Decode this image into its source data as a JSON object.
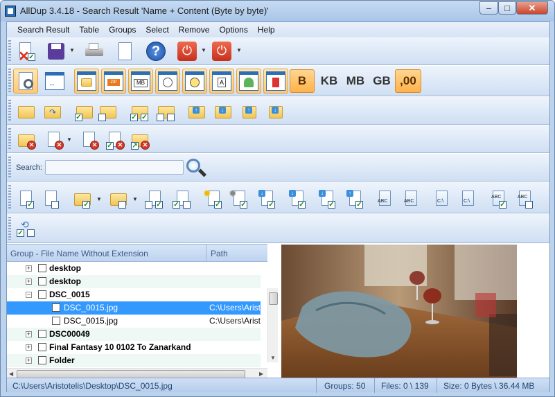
{
  "window": {
    "title": "AllDup 3.4.18 - Search Result 'Name + Content (Byte by byte)'"
  },
  "menu": [
    "Search Result",
    "Table",
    "Groups",
    "Select",
    "Remove",
    "Options",
    "Help"
  ],
  "units": {
    "b": "B",
    "kb": "KB",
    "mb": "MB",
    "gb": "GB",
    "dec": ",00",
    "active": [
      "B",
      ",00"
    ]
  },
  "search": {
    "label": "Search:",
    "value": ""
  },
  "tree": {
    "columns": [
      "Group - File Name Without Extension",
      "Path"
    ],
    "rows": [
      {
        "name": "desktop",
        "bold": true,
        "level": 0,
        "path": ""
      },
      {
        "name": "desktop",
        "bold": true,
        "level": 0,
        "path": ""
      },
      {
        "name": "DSC_0015",
        "bold": true,
        "level": 0,
        "path": ""
      },
      {
        "name": "DSC_0015.jpg",
        "bold": false,
        "level": 1,
        "path": "C:\\Users\\Aristotelis\\Desktop\\",
        "selected": true
      },
      {
        "name": "DSC_0015.jpg",
        "bold": false,
        "level": 1,
        "path": "C:\\Users\\Aristotelis\\Desktop\\"
      },
      {
        "name": "DSC00049",
        "bold": true,
        "level": 0,
        "path": ""
      },
      {
        "name": "Final Fantasy 10 0102 To Zanarkand",
        "bold": true,
        "level": 0,
        "path": ""
      },
      {
        "name": "Folder",
        "bold": true,
        "level": 0,
        "path": ""
      }
    ]
  },
  "status": {
    "path": "C:\\Users\\Aristotelis\\Desktop\\DSC_0015.jpg",
    "groups": "Groups: 50",
    "files": "Files: 0 \\ 139",
    "size": "Size: 0 Bytes \\ 36.44 MB"
  },
  "toolbar1": {
    "icons": [
      "close-results-icon",
      "save-icon",
      "print-icon",
      "document-icon",
      "help-icon",
      "power-save-icon",
      "power-icon"
    ]
  },
  "colors": {
    "accent": "#3399ff",
    "toolbar_active": "#ffc774"
  }
}
